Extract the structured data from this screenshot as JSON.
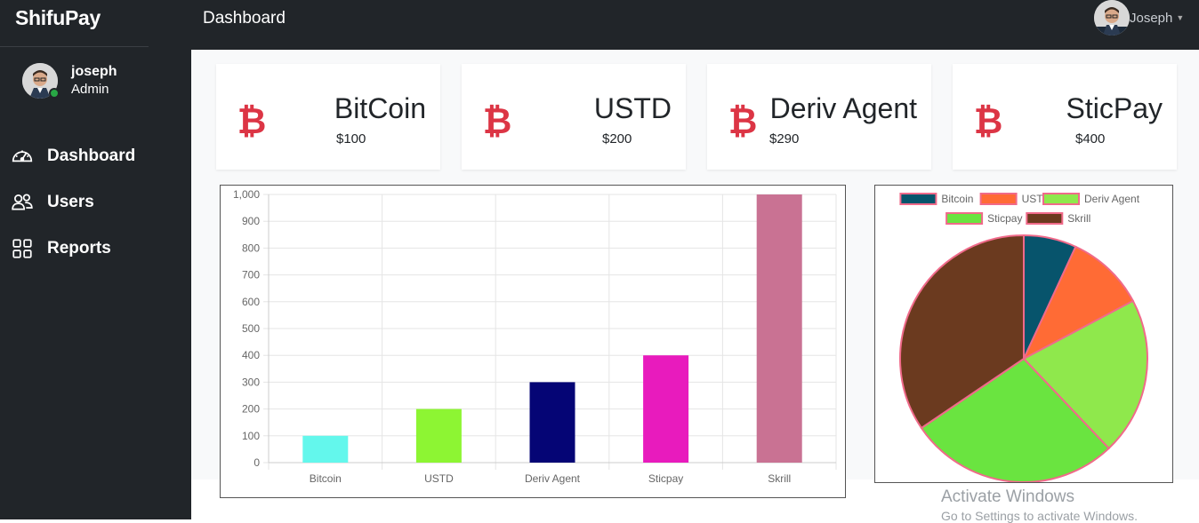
{
  "app": {
    "brand": "ShifuPay",
    "page_title": "Dashboard",
    "user_menu_name": "Joseph"
  },
  "sidebar": {
    "profile": {
      "name": "joseph",
      "role": "Admin"
    },
    "items": [
      {
        "label": "Dashboard",
        "icon": "speedometer-icon"
      },
      {
        "label": "Users",
        "icon": "users-icon"
      },
      {
        "label": "Reports",
        "icon": "grid-icon"
      }
    ]
  },
  "cards": [
    {
      "title": "BitCoin",
      "value": "$100",
      "icon": "bitcoin-icon"
    },
    {
      "title": "USTD",
      "value": "$200",
      "icon": "bitcoin-icon"
    },
    {
      "title": "Deriv Agent",
      "value": "$290",
      "icon": "bitcoin-icon"
    },
    {
      "title": "SticPay",
      "value": "$400",
      "icon": "bitcoin-icon"
    }
  ],
  "colors": {
    "dark": "#212529",
    "accent": "#dc3545",
    "online": "#28a745"
  },
  "chart_data": [
    {
      "type": "bar",
      "categories": [
        "Bitcoin",
        "USTD",
        "Deriv Agent",
        "Sticpay",
        "Skrill"
      ],
      "values": [
        100,
        200,
        300,
        400,
        1000
      ],
      "colors": [
        "#63f7ec",
        "#8df533",
        "#050575",
        "#e81bbd",
        "#c97293"
      ],
      "ylim": [
        0,
        1000
      ],
      "yticks": [
        "0",
        "100",
        "200",
        "300",
        "400",
        "500",
        "600",
        "700",
        "800",
        "900",
        "1,000"
      ],
      "grid": true,
      "legend": "none"
    },
    {
      "type": "pie",
      "labels": [
        "Bitcoin",
        "USTD",
        "Deriv Agent",
        "Sticpay",
        "Skrill"
      ],
      "values": [
        100,
        150,
        300,
        400,
        500
      ],
      "colors": [
        "#07546c",
        "#ff6b35",
        "#8fe84c",
        "#6ae440",
        "#6b3a1f"
      ],
      "border_color": "#f06a8a",
      "legend": "top"
    }
  ],
  "watermark": {
    "line1": "Activate Windows",
    "line2": "Go to Settings to activate Windows."
  }
}
